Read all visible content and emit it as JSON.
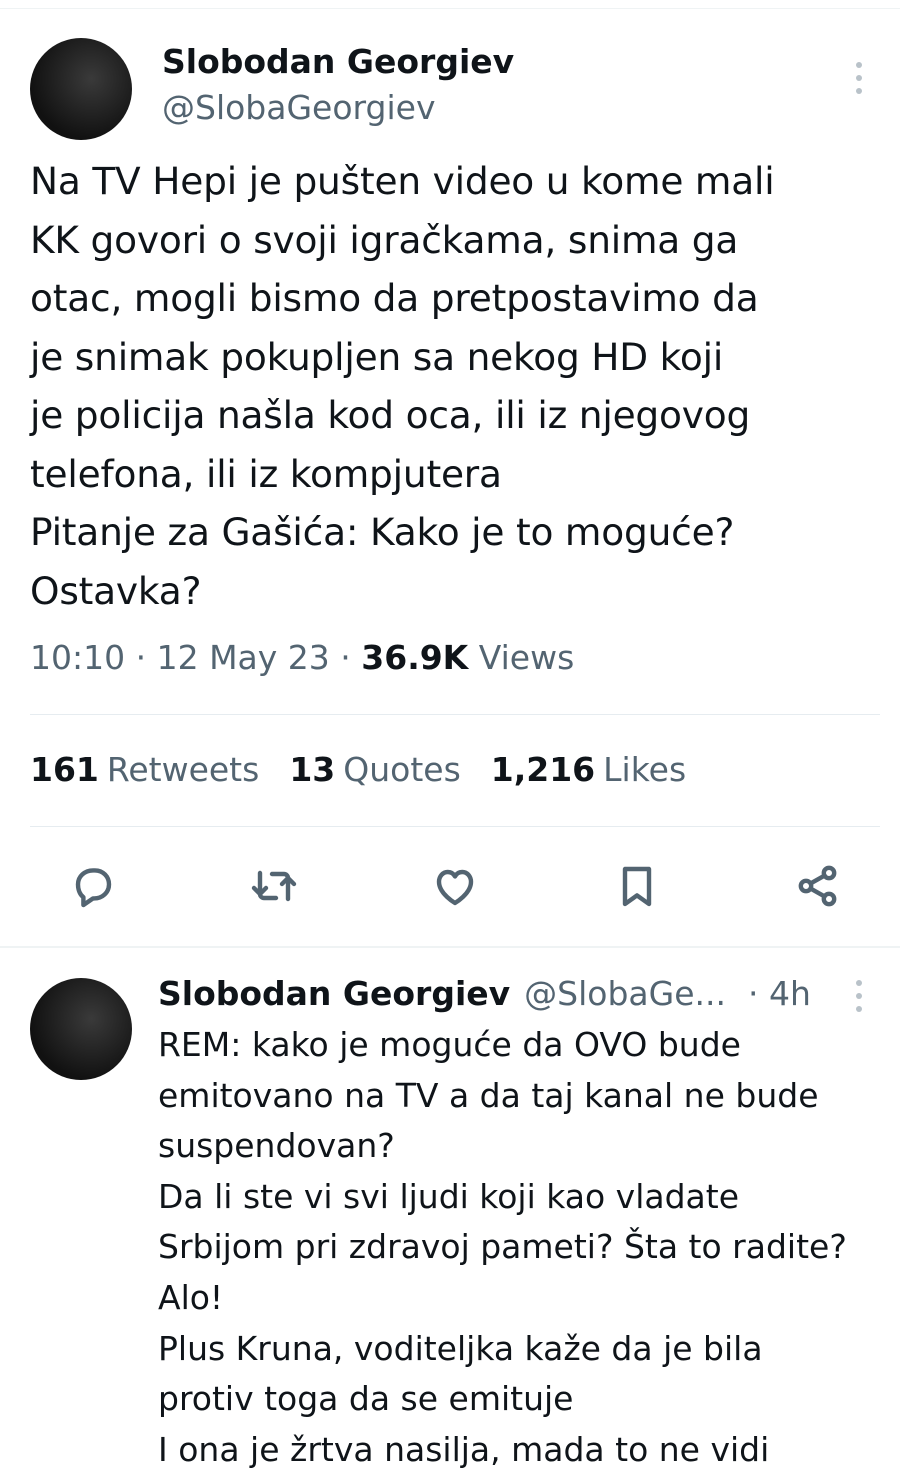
{
  "tweet": {
    "author_name": "Slobodan Georgiev",
    "author_handle": "@SlobaGeorgiev",
    "text": "Na TV Hepi je pušten video u kome mali\nKK govori o svoji igračkama, snima ga\notac, mogli bismo da pretpostavimo da\nje snimak pokupljen sa nekog HD koji\nje policija našla kod oca, ili iz njegovog\ntelefona, ili iz kompjutera\nPitanje za Gašića: Kako je to moguće?\nOstavka?",
    "time": "10:10",
    "date": "12 May 23",
    "views_count": "36.9K",
    "views_label": "Views",
    "retweets_count": "161",
    "retweets_label": "Retweets",
    "quotes_count": "13",
    "quotes_label": "Quotes",
    "likes_count": "1,216",
    "likes_label": "Likes"
  },
  "icons": {
    "actions": [
      "reply-icon",
      "retweet-icon",
      "like-icon",
      "bookmark-icon",
      "share-icon"
    ],
    "more": "more-options-icon"
  },
  "colors": {
    "text": "#0f1419",
    "secondary": "#536471",
    "divider": "#e6ecf0"
  },
  "reply": {
    "author_name": "Slobodan Georgiev",
    "author_handle": "@SlobaGe...",
    "time": "· 4h",
    "text": "REM: kako je moguće da OVO bude\nemitovano na TV a da taj kanal ne bude\nsuspendovan?\nDa li ste vi svi ljudi koji kao vladate\nSrbijom pri zdravoj pameti? Šta to radite?\nAlo!\nPlus Kruna, voditeljka kaže da je bila\nprotiv toga da se emituje\nI ona je žrtva nasilja, mada to ne vidi"
  }
}
